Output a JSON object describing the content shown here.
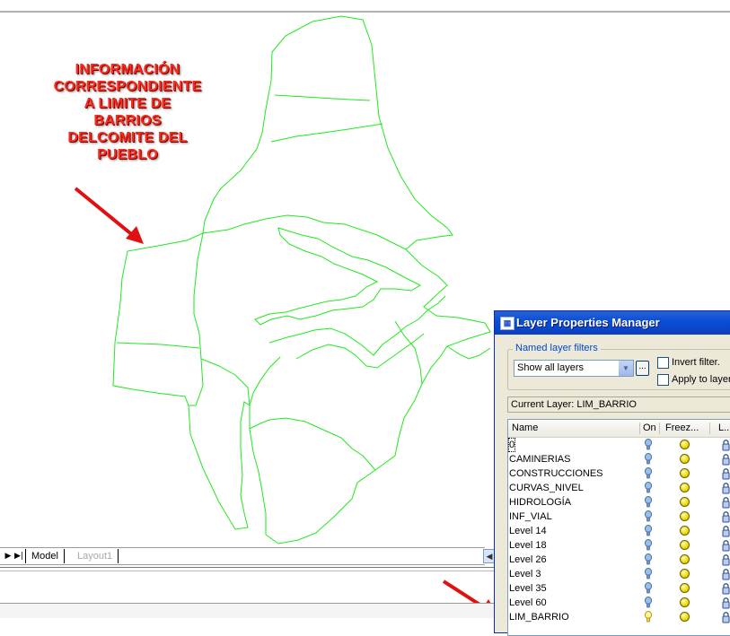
{
  "drawing": {
    "annotation_lines": [
      "INFORMACIÓN",
      "CORRESPONDIENTE",
      "A LIMITE DE",
      "BARRIOS",
      "DELCOMITE DEL",
      "PUEBLO"
    ],
    "boundary_color": "#22e81e",
    "arrow_color": "#e01010"
  },
  "tabs": {
    "model": "Model",
    "layout": "Layout1"
  },
  "dialog": {
    "title": "Layer Properties Manager",
    "filters_group_label": "Named layer filters",
    "filter_selected": "Show all layers",
    "ellipsis_label": "...",
    "invert_filter_label": "Invert filter.",
    "apply_to_layers_label": "Apply to layers",
    "current_layer_text": "Current Layer:  LIM_BARRIO",
    "columns": {
      "name": "Name",
      "on": "On",
      "freeze": "Freez...",
      "lock": "L..."
    },
    "layers": [
      {
        "name": "0",
        "on": true
      },
      {
        "name": "CAMINERIAS",
        "on": true
      },
      {
        "name": "CONSTRUCCIONES",
        "on": true
      },
      {
        "name": "CURVAS_NIVEL",
        "on": true
      },
      {
        "name": "HIDROLOGÍA",
        "on": true
      },
      {
        "name": "INF_VIAL",
        "on": true
      },
      {
        "name": "Level 14",
        "on": true
      },
      {
        "name": "Level 18",
        "on": true
      },
      {
        "name": "Level 26",
        "on": true
      },
      {
        "name": "Level 3",
        "on": true
      },
      {
        "name": "Level 35",
        "on": true
      },
      {
        "name": "Level 60",
        "on": true
      },
      {
        "name": "LIM_BARRIO",
        "on": true,
        "current": true
      }
    ]
  }
}
